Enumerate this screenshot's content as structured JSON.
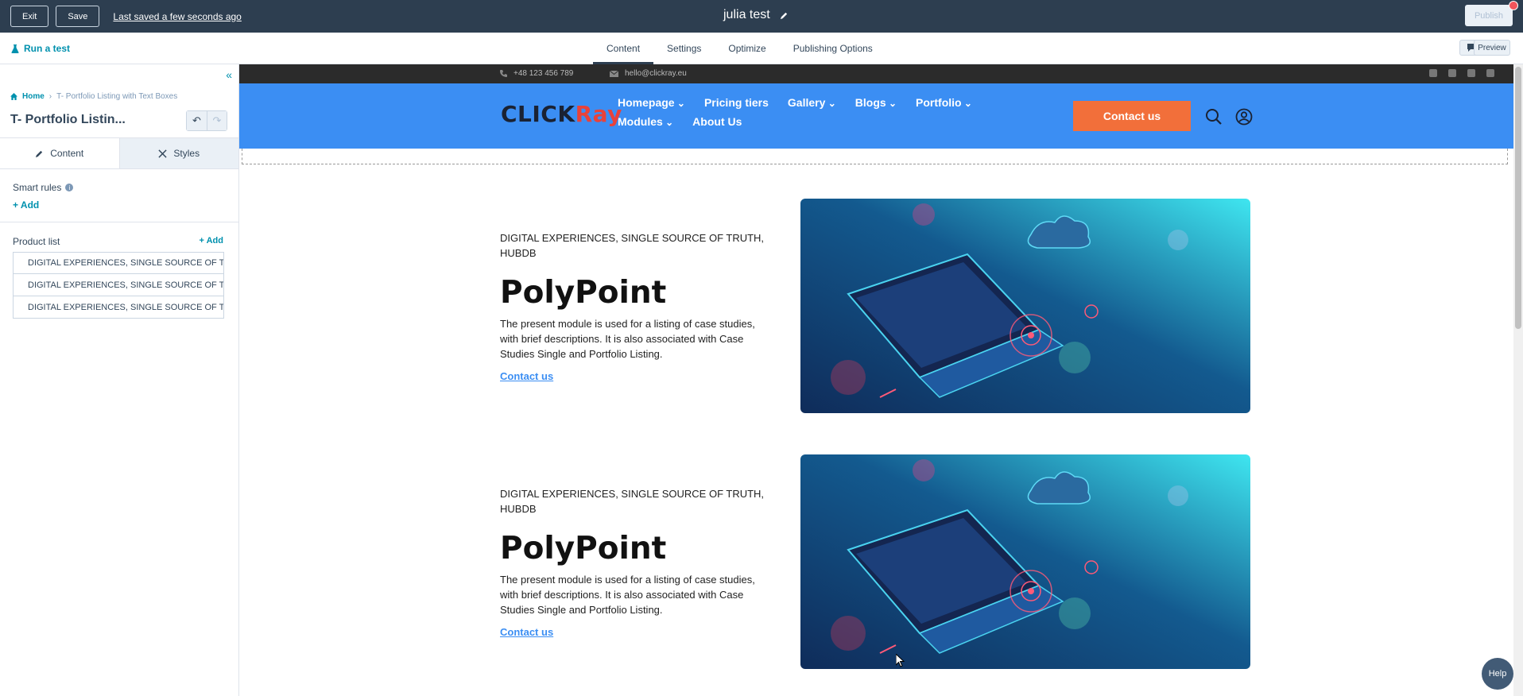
{
  "topbar": {
    "exit_label": "Exit",
    "save_label": "Save",
    "saved_status": "Last saved a few seconds ago",
    "title": "julia test",
    "publish_label": "Publish",
    "notification_count": "1"
  },
  "subnav": {
    "run_test_label": "Run a test",
    "tabs": [
      "Content",
      "Settings",
      "Optimize",
      "Publishing Options"
    ],
    "active_tab": "Content",
    "preview_label": "Preview"
  },
  "sidebar": {
    "breadcrumb_home": "Home",
    "breadcrumb_current": "T- Portfolio Listing with Text Boxes",
    "module_title": "T- Portfolio Listin...",
    "tab_content": "Content",
    "tab_styles": "Styles",
    "smart_rules_label": "Smart rules",
    "smart_rules_add": "Add",
    "product_list_label": "Product list",
    "product_list_add": "+ Add",
    "product_items": [
      "DIGITAL EXPERIENCES, SINGLE SOURCE OF T",
      "DIGITAL EXPERIENCES, SINGLE SOURCE OF T",
      "DIGITAL EXPERIENCES, SINGLE SOURCE OF T"
    ]
  },
  "site": {
    "phone": "+48 123 456 789",
    "email": "hello@clickray.eu",
    "logo_left": "CLICK",
    "logo_right": "Ray",
    "nav": [
      {
        "label": "Homepage",
        "dropdown": true
      },
      {
        "label": "Pricing tiers",
        "dropdown": false
      },
      {
        "label": "Gallery",
        "dropdown": true
      },
      {
        "label": "Blogs",
        "dropdown": true
      },
      {
        "label": "Portfolio",
        "dropdown": true
      },
      {
        "label": "Modules",
        "dropdown": true
      },
      {
        "label": "About Us",
        "dropdown": false
      }
    ],
    "contact_button": "Contact us",
    "header_color": "#3b8ef3",
    "cta_color": "#f26f3a"
  },
  "cards": [
    {
      "eyebrow": "DIGITAL EXPERIENCES, SINGLE SOURCE OF TRUTH, HUBDB",
      "name": "PolyPoint",
      "description": "The present module is used for a listing of case studies, with brief descriptions. It is also associated with Case Studies Single and Portfolio Listing.",
      "cta": "Contact us"
    },
    {
      "eyebrow": "DIGITAL EXPERIENCES, SINGLE SOURCE OF TRUTH, HUBDB",
      "name": "PolyPoint",
      "description": "The present module is used for a listing of case studies, with brief descriptions. It is also associated with Case Studies Single and Portfolio Listing.",
      "cta": "Contact us"
    }
  ],
  "help_label": "Help"
}
